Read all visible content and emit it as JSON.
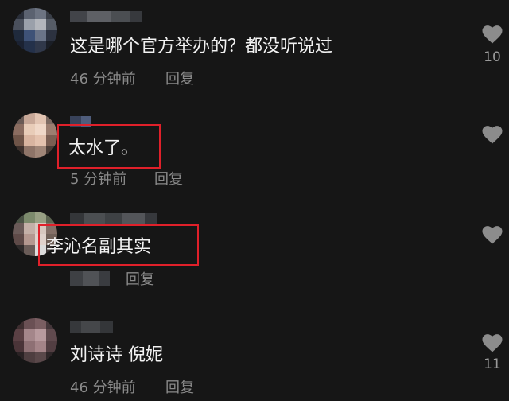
{
  "comments": [
    {
      "text": "这是哪个官方举办的？都没听说过",
      "time": "46 分钟前",
      "reply_label": "回复",
      "likes": "10"
    },
    {
      "text": "太水了。",
      "time": "5 分钟前",
      "reply_label": "回复",
      "likes": ""
    },
    {
      "text": "李沁名副其实",
      "time": "",
      "reply_label": "回复",
      "likes": ""
    },
    {
      "text": "刘诗诗 倪妮",
      "time": "46 分钟前",
      "reply_label": "回复",
      "likes": "11"
    }
  ],
  "colors": {
    "background": "#161616",
    "highlight_box": "#e0202a",
    "meta_text": "#8a8a8a"
  },
  "icons": {
    "like": "heart-icon"
  }
}
